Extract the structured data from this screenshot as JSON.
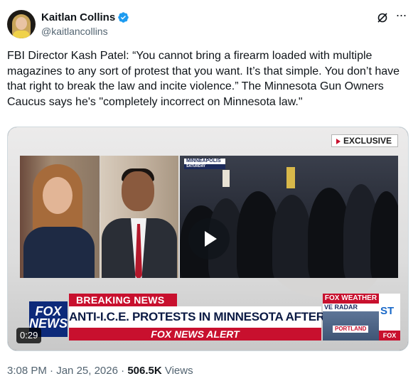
{
  "author": {
    "display_name": "Kaitlan Collins",
    "handle": "@kaitlancollins",
    "verified": true,
    "verified_color": "#1d9bf0"
  },
  "tweet": {
    "text": "FBI Director Kash Patel: “You cannot bring a firearm loaded with multiple magazines to any sort of protest that you want. It’s that simple. You don’t have that right to break the law and incite violence.” The Minnesota Gun Owners Caucus says he's \"completely incorrect on Minnesota law.\""
  },
  "video": {
    "duration": "0:29",
    "location_tag": "MINNEAPOLIS",
    "location_day": "SATURDAY",
    "exclusive_label": "EXCLUSIVE",
    "breaking_label": "BREAKING NEWS",
    "headline": "ANTI-I.C.E. PROTESTS IN MINNESOTA AFTER SHOOTING",
    "alert_label": "FOX NEWS ALERT",
    "logo_text": "FOX NEWS",
    "weather_title": "FOX WEATHER",
    "weather_radar": "VE RADAR",
    "weather_city": "PORTLAND",
    "side_text": "ST",
    "side_bottom": "FOX"
  },
  "meta": {
    "time": "3:08 PM",
    "date": "Jan 25, 2026",
    "views_count": "506.5K",
    "views_label": "Views"
  },
  "icons": {
    "grok": "grok-icon",
    "more": "more-icon",
    "play": "play-icon"
  }
}
